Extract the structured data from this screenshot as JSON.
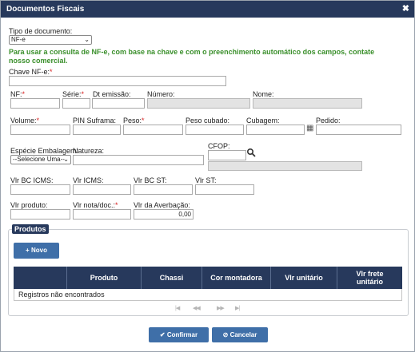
{
  "dialog": {
    "title": "Documentos Fiscais",
    "close_symbol": "✖"
  },
  "tipo_documento": {
    "label": "Tipo de documento:",
    "value": "NF-e"
  },
  "info_text_1": "Para usar a consulta de NF-e, com base na chave e com o preenchimento automático dos campos, contate",
  "info_text_2": "nosso comercial.",
  "chave": {
    "label": "Chave NF-e:",
    "value": ""
  },
  "labels": {
    "nf": "NF:",
    "serie": "Série:",
    "dt_emissao": "Dt emissão:",
    "numero": "Número:",
    "nome": "Nome:",
    "volume": "Volume:",
    "pin_suframa": "PIN Suframa:",
    "peso": "Peso:",
    "peso_cubado": "Peso cubado:",
    "cubagem": "Cubagem:",
    "pedido": "Pedido:",
    "especie": "Espécie Embalagem:",
    "natureza": "Natureza:",
    "cfop": "CFOP:",
    "vlr_bc_icms": "Vlr BC ICMS:",
    "vlr_icms": "Vlr ICMS:",
    "vlr_bc_st": "Vlr BC ST:",
    "vlr_st": "Vlr ST:",
    "vlr_produto": "Vlr produto:",
    "vlr_nota": "Vlr nota/doc.:",
    "vlr_averbacao": "Vlr da Averbação:"
  },
  "required_mark": "*",
  "especie_select": {
    "value": "--Selecione Uma--"
  },
  "vlr_averbacao_value": "0,00",
  "produtos": {
    "legend": "Produtos",
    "novo_button": "Novo",
    "columns": [
      "Produto",
      "Chassi",
      "Cor montadora",
      "Vlr unitário",
      "Vlr frete unitário"
    ],
    "empty_message": "Registros não encontrados",
    "pager": {
      "first": "|◀",
      "prev": "◀◀",
      "next": "▶▶",
      "last": "▶|"
    }
  },
  "footer": {
    "confirm": "Confirmar",
    "cancel": "Cancelar"
  }
}
